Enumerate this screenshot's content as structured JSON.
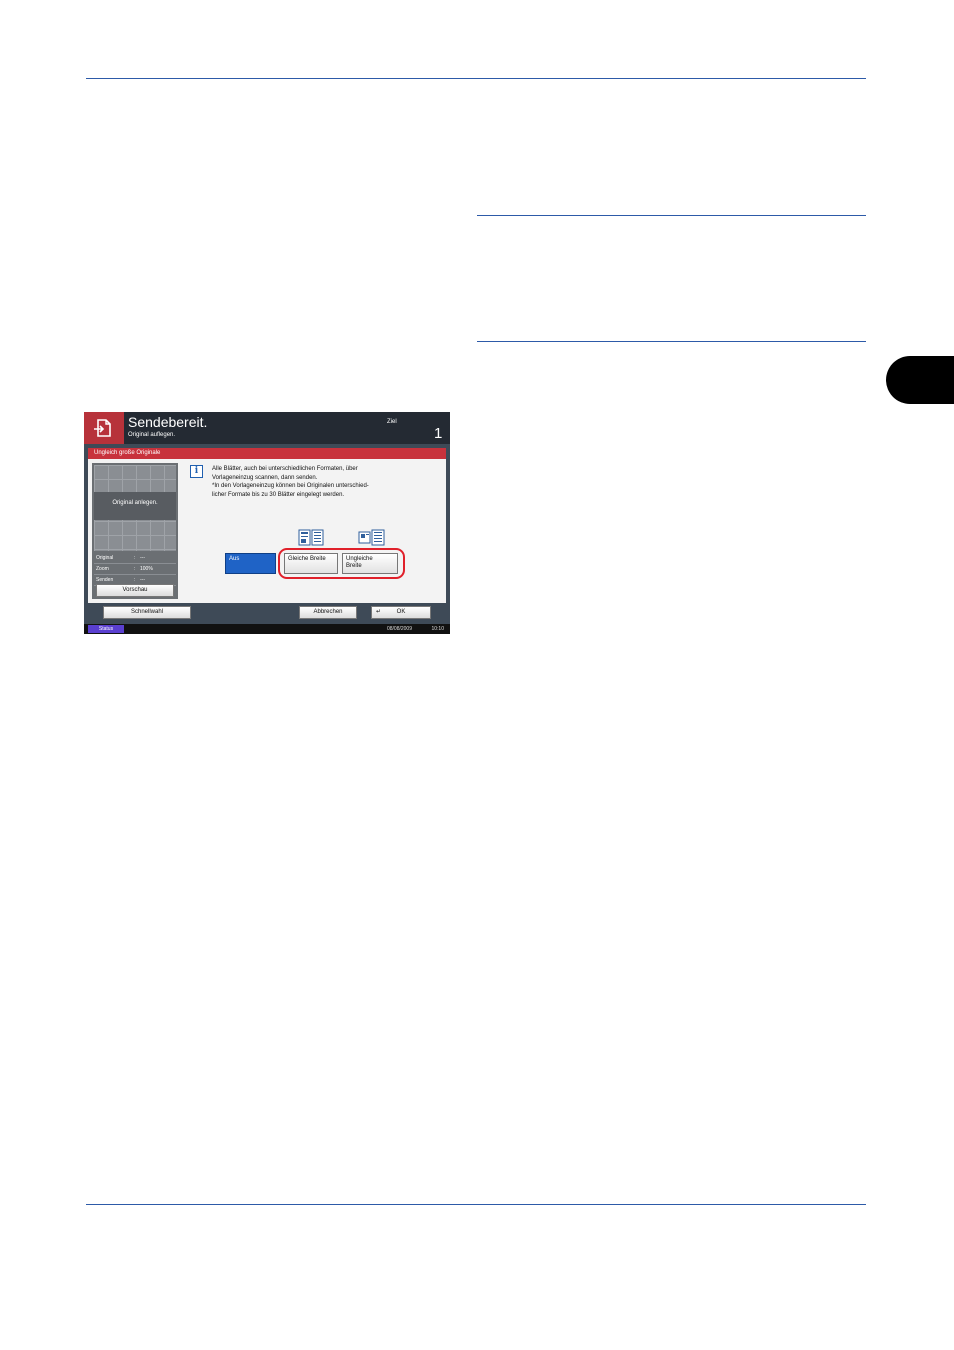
{
  "screen": {
    "title": "Sendebereit.",
    "subtitle": "Original auflegen.",
    "destination_label": "Ziel",
    "destination_count": "1"
  },
  "dialog": {
    "title": "Ungleich große Originale",
    "message_lines": [
      "Alle Blätter, auch bei unterschiedlichen Formaten, über",
      "Vorlageneinzug scannen, dann senden.",
      "*In den Vorlageneinzug können bei Originalen unterschied-",
      "licher Formate bis zu 30 Blätter eingelegt werden."
    ],
    "options": [
      {
        "label": "Aus",
        "selected": true
      },
      {
        "label": "Gleiche Breite",
        "selected": false,
        "icon": "same-width-originals-icon"
      },
      {
        "label_line1": "Ungleiche",
        "label_line2": "Breite",
        "selected": false,
        "icon": "different-width-originals-icon"
      }
    ]
  },
  "preview": {
    "placeholder": "Original anlegen.",
    "rows": [
      {
        "label": "Original",
        "sep": ":",
        "value": "---"
      },
      {
        "label": "Zoom",
        "sep": ":",
        "value": "100%"
      },
      {
        "label": "Senden",
        "sep": ":",
        "value": "---"
      }
    ],
    "button": "Vorschau"
  },
  "footer": {
    "quick_dial": "Schnellwahl",
    "cancel": "Abbrechen",
    "ok": "OK"
  },
  "statusbar": {
    "status": "Status",
    "date": "08/08/2009",
    "time": "10:10"
  },
  "colors": {
    "rule": "#2d5aa8",
    "header_accent": "#b7323a",
    "titlebar": "#c8323c",
    "selected_button": "#1f63c6",
    "highlight_ring": "#e0202a"
  }
}
